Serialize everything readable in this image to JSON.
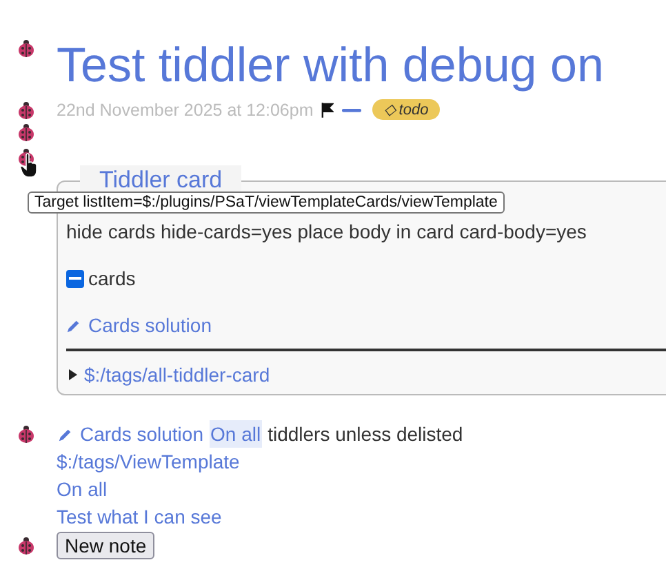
{
  "title": "Test tiddler with debug on",
  "meta": {
    "date": "22nd November 2025 at 12:06pm",
    "tag": {
      "label": "◇ todo",
      "color": "#ecc859"
    }
  },
  "tooltip": "Target listItem=$:/plugins/PSaT/viewTemplateCards/viewTemplate",
  "card": {
    "legend": "Tiddler card",
    "text": "hide cards hide-cards=yes place body in card card-body=yes",
    "checkbox": {
      "label": "cards",
      "indeterminate": true
    },
    "link": "Cards solution",
    "details": {
      "label": "$:/tags/all-tiddler-card",
      "expanded": false
    }
  },
  "footer": {
    "link": "Cards solution",
    "highlight_link": {
      "label": "On all",
      "highlighted": true
    },
    "text": "tiddlers unless delisted",
    "lines": [
      "$:/tags/ViewTemplate",
      "On all",
      "Test what I can see"
    ],
    "button": "New note"
  }
}
